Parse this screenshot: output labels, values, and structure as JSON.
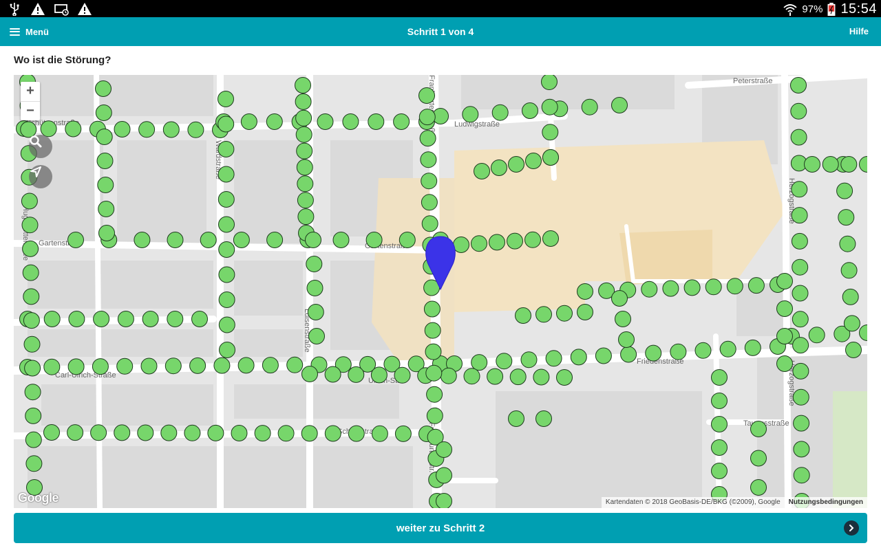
{
  "statusbar": {
    "battery": "97%",
    "time": "15:54",
    "icons": [
      "usb-icon",
      "warning-icon",
      "cast-icon",
      "warning-icon",
      "wifi-icon",
      "battery-icon"
    ]
  },
  "appbar": {
    "menu_label": "Menü",
    "title": "Schritt 1 von 4",
    "help_label": "Hilfe",
    "color": "#009fb2"
  },
  "question": "Wo ist die Störung?",
  "map": {
    "zoom_in": "+",
    "zoom_out": "−",
    "google_logo": "Google",
    "attribution": "Kartendaten © 2018 GeoBasis-DE/BKG (©2009), Google",
    "terms": "Nutzungsbedingungen",
    "street_labels": [
      "Peterstraße",
      "Schützenstraße",
      "Wardstraße",
      "Hugenottenallee",
      "Gartenstraße",
      "Luisenstraße",
      "Carl-Ulrich-Straße",
      "Ulrich-Str.",
      "Friedenstraße",
      "Herzogstraße",
      "Frankfurter Straße",
      "Schloßstraße",
      "Taunusstraße",
      "Frankfurter Str.",
      "Luisenstraße",
      "Ludwigstraße"
    ],
    "marker_color": "#3b33e8",
    "point_color": "#77d66b"
  },
  "next_button": {
    "label": "weiter zu Schritt 2"
  }
}
